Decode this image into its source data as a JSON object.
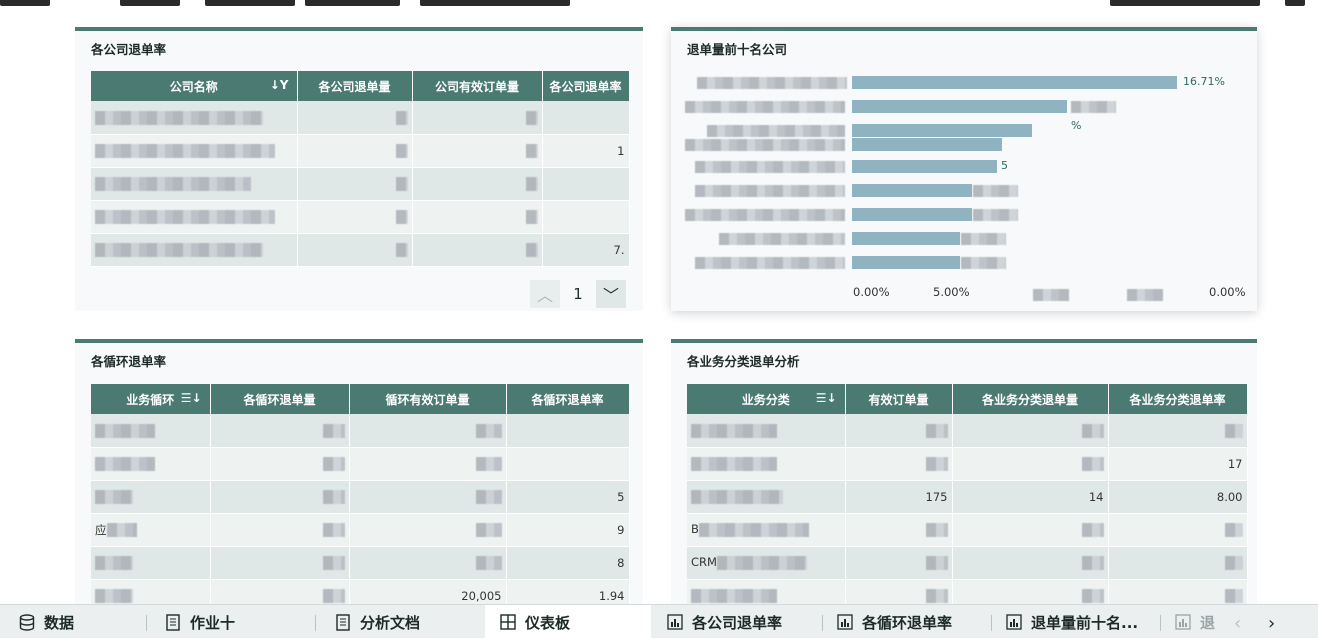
{
  "panels": {
    "company_rate": {
      "title": "各公司退单率",
      "columns": [
        "公司名称",
        "各公司退单量",
        "公司有效订单量",
        "各公司退单率"
      ],
      "rows": [
        {
          "rate": ""
        },
        {
          "rate": "1"
        },
        {
          "rate": ""
        },
        {
          "rate": ""
        },
        {
          "rate": "7."
        }
      ],
      "pager": {
        "page": "1"
      }
    },
    "top10": {
      "title": "退单量前十名公司",
      "bar_labels": [
        "16.71%",
        "",
        "%",
        "5",
        "",
        "",
        "",
        ""
      ],
      "x_ticks": [
        "0.00%",
        "5.00%",
        "0.00%"
      ]
    },
    "cycle_rate": {
      "title": "各循环退单率",
      "columns": [
        "业务循环",
        "各循环退单量",
        "循环有效订单量",
        "各循环退单率"
      ],
      "rows": [
        {
          "prefix": "",
          "valid": "",
          "rate": ""
        },
        {
          "prefix": "",
          "valid": "",
          "rate": ""
        },
        {
          "prefix": "",
          "valid": "",
          "rate": "5"
        },
        {
          "prefix": "应",
          "valid": "",
          "rate": "9"
        },
        {
          "prefix": "",
          "valid": "",
          "rate": "8"
        },
        {
          "prefix": "",
          "valid": "20,005",
          "rate": "1.94"
        }
      ]
    },
    "category": {
      "title": "各业务分类退单分析",
      "columns": [
        "业务分类",
        "有效订单量",
        "各业务分类退单量",
        "各业务分类退单率"
      ],
      "rows": [
        {
          "prefix": "",
          "valid": "",
          "returns": "",
          "rate": ""
        },
        {
          "prefix": "",
          "valid": "",
          "returns": "",
          "rate": "17"
        },
        {
          "prefix": "",
          "valid": "175",
          "returns": "14",
          "rate": "8.00"
        },
        {
          "prefix": "B",
          "valid": "",
          "returns": "",
          "rate": ""
        },
        {
          "prefix": "CRM",
          "valid": "",
          "returns": "",
          "rate": ""
        },
        {
          "prefix": "",
          "valid": "",
          "returns": "",
          "rate": ""
        }
      ]
    }
  },
  "tabs": {
    "data": "数据",
    "job": "作业十",
    "doc": "分析文档",
    "dashboard": "仪表板",
    "t1": "各公司退单率",
    "t2": "各循环退单率",
    "t3": "退单量前十名...",
    "t4": "退"
  },
  "colors": {
    "header": "#4a7a72",
    "bar": "#8fb3c0",
    "row_alt": "#dfe8e6"
  }
}
